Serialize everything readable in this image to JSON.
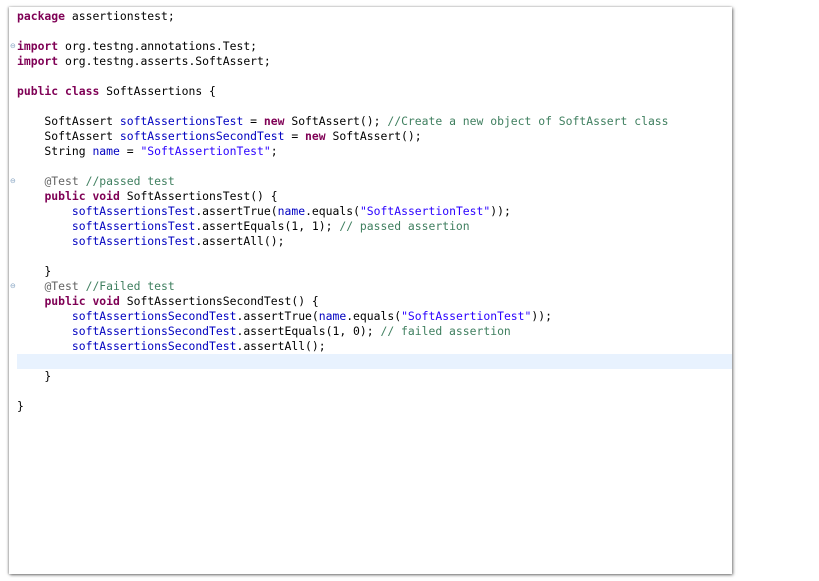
{
  "editor": {
    "colors": {
      "keyword": "#7f0055",
      "field": "#0000c0",
      "string": "#2a00ff",
      "comment": "#3f7f5f",
      "annotation": "#646464",
      "current_line": "#e8f2fe"
    },
    "fold_icon": "fold-minus-icon",
    "lines": [
      [
        {
          "t": "package",
          "c": "kw"
        },
        {
          "t": " assertionstest;",
          "c": ""
        }
      ],
      [],
      [
        {
          "t": "import",
          "c": "kw"
        },
        {
          "t": " org.testng.annotations.Test;",
          "c": ""
        }
      ],
      [
        {
          "t": "import",
          "c": "kw"
        },
        {
          "t": " org.testng.asserts.SoftAssert;",
          "c": ""
        }
      ],
      [],
      [
        {
          "t": "public",
          "c": "kw"
        },
        {
          "t": " ",
          "c": ""
        },
        {
          "t": "class",
          "c": "kw"
        },
        {
          "t": " SoftAssertions {",
          "c": ""
        }
      ],
      [],
      [
        {
          "t": "    SoftAssert ",
          "c": ""
        },
        {
          "t": "softAssertionsTest",
          "c": "field"
        },
        {
          "t": " = ",
          "c": ""
        },
        {
          "t": "new",
          "c": "kw"
        },
        {
          "t": " SoftAssert(); ",
          "c": ""
        },
        {
          "t": "//Create a new object of SoftAssert class",
          "c": "cmt"
        }
      ],
      [
        {
          "t": "    SoftAssert ",
          "c": ""
        },
        {
          "t": "softAssertionsSecondTest",
          "c": "field"
        },
        {
          "t": " = ",
          "c": ""
        },
        {
          "t": "new",
          "c": "kw"
        },
        {
          "t": " SoftAssert();",
          "c": ""
        }
      ],
      [
        {
          "t": "    String ",
          "c": ""
        },
        {
          "t": "name",
          "c": "field"
        },
        {
          "t": " = ",
          "c": ""
        },
        {
          "t": "\"SoftAssertionTest\"",
          "c": "str"
        },
        {
          "t": ";",
          "c": ""
        }
      ],
      [],
      [
        {
          "t": "    ",
          "c": ""
        },
        {
          "t": "@Test",
          "c": "ann"
        },
        {
          "t": " ",
          "c": ""
        },
        {
          "t": "//passed test",
          "c": "cmt"
        }
      ],
      [
        {
          "t": "    ",
          "c": ""
        },
        {
          "t": "public",
          "c": "kw"
        },
        {
          "t": " ",
          "c": ""
        },
        {
          "t": "void",
          "c": "kw"
        },
        {
          "t": " SoftAssertionsTest() {",
          "c": ""
        }
      ],
      [
        {
          "t": "        ",
          "c": ""
        },
        {
          "t": "softAssertionsTest",
          "c": "field"
        },
        {
          "t": ".assertTrue(",
          "c": ""
        },
        {
          "t": "name",
          "c": "field"
        },
        {
          "t": ".equals(",
          "c": ""
        },
        {
          "t": "\"SoftAssertionTest\"",
          "c": "str"
        },
        {
          "t": "));",
          "c": ""
        }
      ],
      [
        {
          "t": "        ",
          "c": ""
        },
        {
          "t": "softAssertionsTest",
          "c": "field"
        },
        {
          "t": ".assertEquals(1, 1); ",
          "c": ""
        },
        {
          "t": "// passed assertion",
          "c": "cmt"
        }
      ],
      [
        {
          "t": "        ",
          "c": ""
        },
        {
          "t": "softAssertionsTest",
          "c": "field"
        },
        {
          "t": ".assertAll();",
          "c": ""
        }
      ],
      [],
      [
        {
          "t": "    }",
          "c": ""
        }
      ],
      [
        {
          "t": "    ",
          "c": ""
        },
        {
          "t": "@Test",
          "c": "ann"
        },
        {
          "t": " ",
          "c": ""
        },
        {
          "t": "//Failed test",
          "c": "cmt"
        }
      ],
      [
        {
          "t": "    ",
          "c": ""
        },
        {
          "t": "public",
          "c": "kw"
        },
        {
          "t": " ",
          "c": ""
        },
        {
          "t": "void",
          "c": "kw"
        },
        {
          "t": " SoftAssertionsSecondTest() {",
          "c": ""
        }
      ],
      [
        {
          "t": "        ",
          "c": ""
        },
        {
          "t": "softAssertionsSecondTest",
          "c": "field"
        },
        {
          "t": ".assertTrue(",
          "c": ""
        },
        {
          "t": "name",
          "c": "field"
        },
        {
          "t": ".equals(",
          "c": ""
        },
        {
          "t": "\"SoftAssertionTest\"",
          "c": "str"
        },
        {
          "t": "));",
          "c": ""
        }
      ],
      [
        {
          "t": "        ",
          "c": ""
        },
        {
          "t": "softAssertionsSecondTest",
          "c": "field"
        },
        {
          "t": ".assertEquals(1, 0); ",
          "c": ""
        },
        {
          "t": "// failed assertion",
          "c": "cmt"
        }
      ],
      [
        {
          "t": "        ",
          "c": ""
        },
        {
          "t": "softAssertionsSecondTest",
          "c": "field"
        },
        {
          "t": ".assertAll();",
          "c": ""
        }
      ],
      [],
      [
        {
          "t": "    }",
          "c": ""
        }
      ],
      [],
      [
        {
          "t": "}",
          "c": ""
        }
      ]
    ],
    "fold_lines": [
      2,
      11,
      18
    ],
    "current_line": 23
  }
}
